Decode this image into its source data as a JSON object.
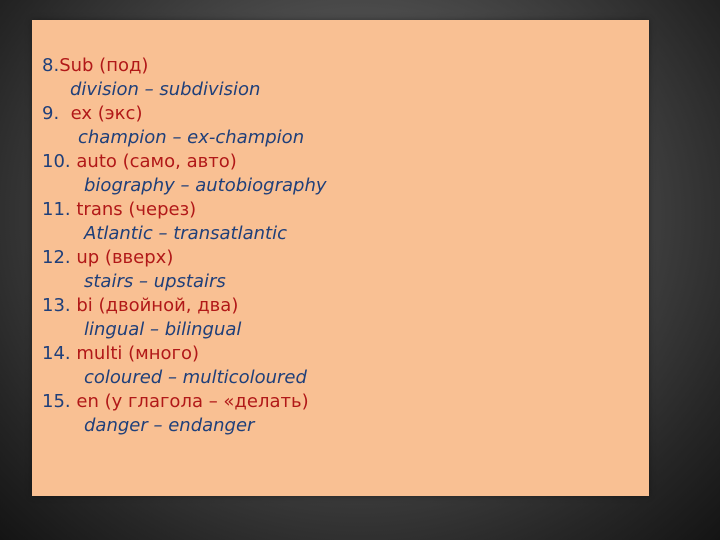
{
  "items": [
    {
      "num": "8.",
      "prefix": "Sub (под)",
      "example": "division – subdivision"
    },
    {
      "num": "9.",
      "prefix": "ex (экс)",
      "example": "champion – ex-champion"
    },
    {
      "num": "10.",
      "prefix": "auto (само, авто)",
      "example": "biography – autobiography"
    },
    {
      "num": "11.",
      "prefix": "trans (через)",
      "example": "Atlantic – transatlantic"
    },
    {
      "num": "12.",
      "prefix": "up (вверх)",
      "example": "stairs – upstairs"
    },
    {
      "num": "13.",
      "prefix": "bi (двойной, два)",
      "example": "lingual – bilingual"
    },
    {
      "num": "14.",
      "prefix": "multi (много)",
      "example": "coloured – multicoloured"
    },
    {
      "num": "15.",
      "prefix": "en (у глагола – «делать)",
      "example": "danger – endanger"
    }
  ],
  "colors": {
    "panel": "#f9c093",
    "prefix_text": "#b11818",
    "example_text": "#1f3f7a",
    "number_text": "#1f3f7a",
    "background": "#3a3a3a"
  }
}
